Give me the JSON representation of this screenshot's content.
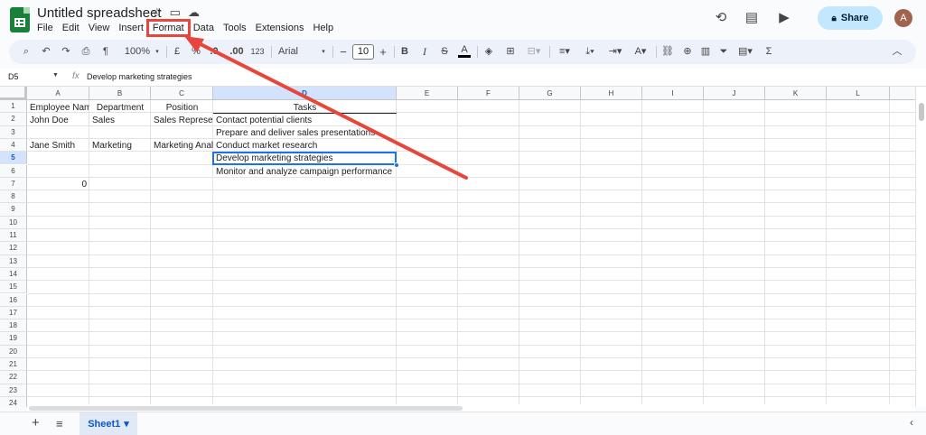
{
  "app": {
    "doc_title": "Untitled spreadsheet",
    "menu": [
      "File",
      "Edit",
      "View",
      "Insert",
      "Format",
      "Data",
      "Tools",
      "Extensions",
      "Help"
    ],
    "highlighted_menu": "Format",
    "share_label": "Share",
    "avatar_initial": "A",
    "accent_color": "#e8453c",
    "brand_color": "#188038"
  },
  "toolbar": {
    "zoom": "100%",
    "currency": "£",
    "percent": "%",
    "dec_decrease": ".0",
    "dec_increase": ".00",
    "number_format": "123",
    "font": "Arial",
    "font_size": "10",
    "minus": "−",
    "plus": "+",
    "bold": "B",
    "italic": "I",
    "strike": "S",
    "text_color": "A",
    "sum": "Σ"
  },
  "formula_bar": {
    "cell_ref": "D5",
    "fx": "fx",
    "value": "Develop marketing strategies"
  },
  "columns": [
    "A",
    "B",
    "C",
    "D",
    "E",
    "F",
    "G",
    "H",
    "I",
    "J",
    "K",
    "L"
  ],
  "rows": [
    "1",
    "2",
    "3",
    "4",
    "5",
    "6",
    "7",
    "8",
    "9",
    "10",
    "11",
    "12",
    "13",
    "14",
    "15",
    "16",
    "17",
    "18",
    "19",
    "20",
    "21",
    "22",
    "23",
    "24"
  ],
  "cells": {
    "A1": "Employee Name",
    "B1": "Department",
    "C1": "Position",
    "D1": "Tasks",
    "A2": "John Doe",
    "B2": "Sales",
    "C2": "Sales Represent",
    "D2": "Contact potential clients",
    "D3": "Prepare and deliver sales presentations",
    "A4": "Jane Smith",
    "B4": "Marketing",
    "C4": "Marketing Analy",
    "D4": "Conduct market research",
    "D5": "Develop marketing strategies",
    "D6": "Monitor and analyze campaign performance",
    "A7": "0"
  },
  "sheet_tab": "Sheet1",
  "icons": {
    "undo": "↶",
    "redo": "↷",
    "search": "⌕",
    "print": "⎙",
    "star": "☆",
    "cloud": "☁",
    "history": "⟲",
    "comment": "▤",
    "meet": "▶",
    "lock": "🔒",
    "sheet_dropdown": "▾",
    "collapse": "︿",
    "left": "‹"
  }
}
